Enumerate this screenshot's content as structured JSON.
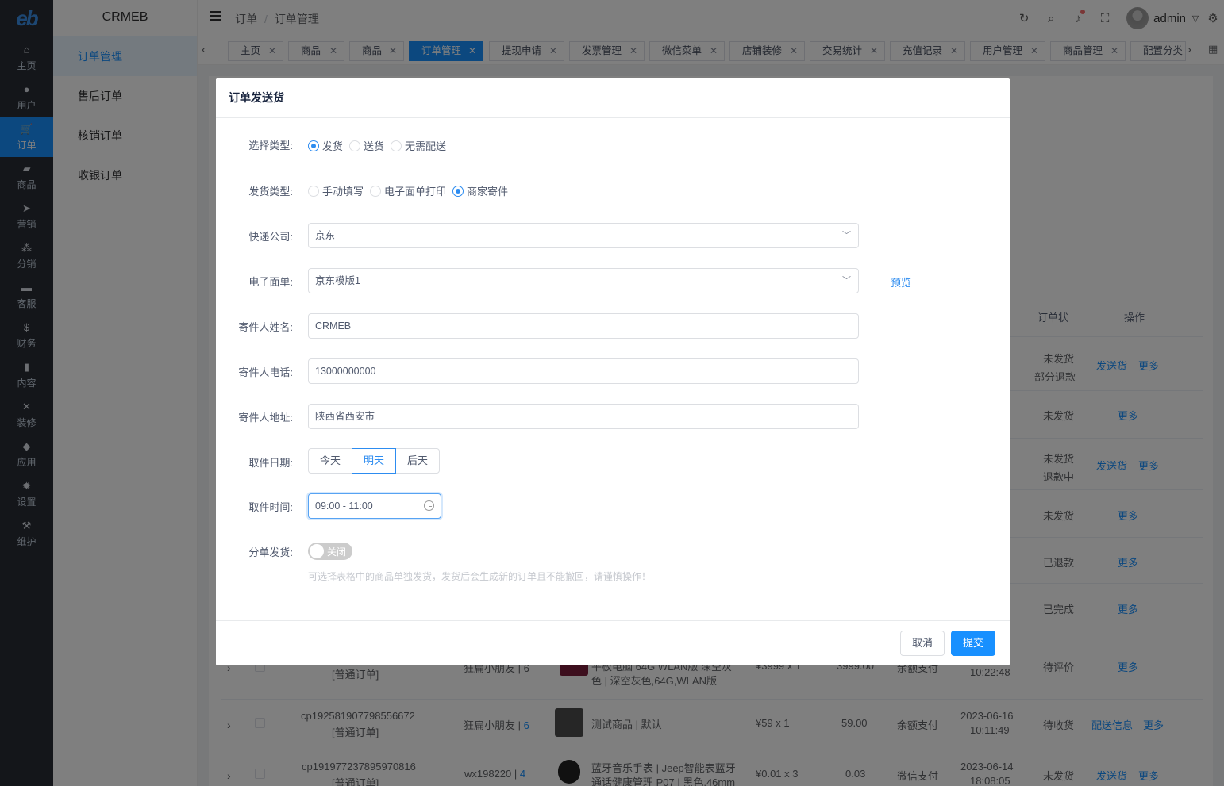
{
  "sidebar": {
    "logo": "eb",
    "items": [
      {
        "icon": "home-icon",
        "glyph": "⌂",
        "label": "主页"
      },
      {
        "icon": "user-icon",
        "glyph": "●",
        "label": "用户"
      },
      {
        "icon": "cart-icon",
        "glyph": "🛒",
        "label": "订单"
      },
      {
        "icon": "bag-icon",
        "glyph": "▰",
        "label": "商品"
      },
      {
        "icon": "send-icon",
        "glyph": "➤",
        "label": "营销"
      },
      {
        "icon": "people-icon",
        "glyph": "⁂",
        "label": "分销"
      },
      {
        "icon": "chat-icon",
        "glyph": "▬",
        "label": "客服"
      },
      {
        "icon": "dollar-icon",
        "glyph": "$",
        "label": "财务"
      },
      {
        "icon": "book-icon",
        "glyph": "▮",
        "label": "内容"
      },
      {
        "icon": "tools-icon",
        "glyph": "✕",
        "label": "装修"
      },
      {
        "icon": "cube-icon",
        "glyph": "◆",
        "label": "应用"
      },
      {
        "icon": "gear-icon",
        "glyph": "✹",
        "label": "设置"
      },
      {
        "icon": "hammer-icon",
        "glyph": "⚒",
        "label": "维护"
      }
    ]
  },
  "subbar": {
    "brand": "CRMEB",
    "items": [
      "订单管理",
      "售后订单",
      "核销订单",
      "收银订单"
    ]
  },
  "header": {
    "crumb_1": "订单",
    "crumb_sep": "/",
    "crumb_2": "订单管理",
    "user": "admin"
  },
  "tabs": [
    "主页",
    "商品",
    "商品",
    "订单管理",
    "提现申请",
    "发票管理",
    "微信菜单",
    "店铺装修",
    "交易统计",
    "充值记录",
    "用户管理",
    "商品管理",
    "配置分类"
  ],
  "background": {
    "col_status": "订单状",
    "col_action": "操作",
    "status": [
      "未发货",
      "部分退款",
      "未发货",
      "未发货",
      "退款中",
      "未发货",
      "已退款",
      "已完成",
      "待评价",
      "待收货",
      "未发货"
    ],
    "actions": {
      "ship": "发送货",
      "more": "更多",
      "delivery_info": "配送信息"
    },
    "row_a": {
      "order_no": "[普通订单]",
      "user": "狂扁小朋友 | 6",
      "product": "色 | 深空灰色,64G,WLAN版",
      "product_top": "平板电脑 64G WLAN版 深空灰",
      "price": "¥3999 x 1",
      "paid": "3999.00",
      "pay": "余额支付",
      "time": "10:22:48"
    },
    "row_b": {
      "order_no": "cp192581907798556672",
      "type": "[普通订单]",
      "user": "狂扁小朋友 |",
      "user_id": "6",
      "product": "测试商品 | 默认",
      "price": "¥59 x 1",
      "paid": "59.00",
      "pay": "余额支付",
      "date": "2023-06-16",
      "time": "10:11:49"
    },
    "row_c": {
      "order_no": "cp191977237895970816",
      "type": "[普通订单]",
      "user": "wx198220 |",
      "user_id": "4",
      "product": "蓝牙音乐手表 | Jeep智能表蓝牙",
      "product2": "通话健康管理 P07 | 黑色,46mm",
      "price": "¥0.01 x 3",
      "paid": "0.03",
      "pay": "微信支付",
      "date": "2023-06-14",
      "time": "18:08:05"
    }
  },
  "modal": {
    "title": "订单发送货",
    "type_label": "选择类型:",
    "type_options": [
      "发货",
      "送货",
      "无需配送"
    ],
    "ship_type_label": "发货类型:",
    "ship_type_options": [
      "手动填写",
      "电子面单打印",
      "商家寄件"
    ],
    "express_label": "快递公司:",
    "express_value": "京东",
    "waybill_label": "电子面单:",
    "waybill_value": "京东模版1",
    "preview": "预览",
    "sender_name_label": "寄件人姓名:",
    "sender_name": "CRMEB",
    "sender_phone_label": "寄件人电话:",
    "sender_phone": "13000000000",
    "sender_addr_label": "寄件人地址:",
    "sender_addr": "陕西省西安市",
    "pickup_date_label": "取件日期:",
    "pickup_dates": [
      "今天",
      "明天",
      "后天"
    ],
    "pickup_time_label": "取件时间:",
    "pickup_time": "09:00 - 11:00",
    "split_label": "分单发货:",
    "split_state": "关闭",
    "hint": "可选择表格中的商品单独发货，发货后会生成新的订单且不能撤回，请谨慎操作！",
    "cancel": "取消",
    "submit": "提交"
  },
  "colors": {
    "primary": "#1890ff",
    "sidebar_bg": "#282c34"
  }
}
